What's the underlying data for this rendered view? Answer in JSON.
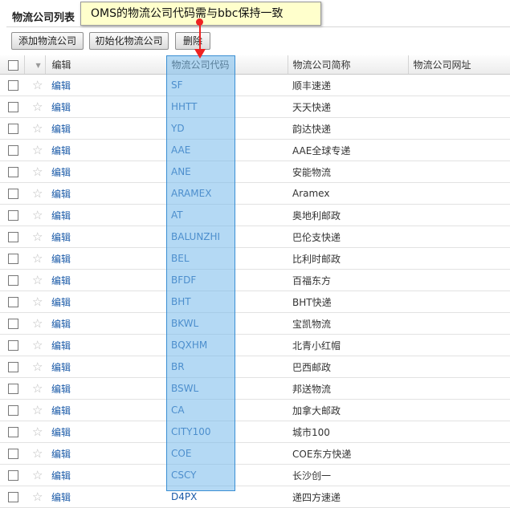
{
  "page": {
    "title": "物流公司列表"
  },
  "toolbar": {
    "add_label": "添加物流公司",
    "init_label": "初始化物流公司",
    "delete_label": "删除"
  },
  "annotation": {
    "text": "OMS的物流公司代码需与bbc保持一致"
  },
  "table": {
    "headers": {
      "edit": "编辑",
      "code": "物流公司代码",
      "name": "物流公司简称",
      "url": "物流公司网址"
    },
    "rows": [
      {
        "edit": "编辑",
        "code": "SF",
        "name": "顺丰速递"
      },
      {
        "edit": "编辑",
        "code": "HHTT",
        "name": "天天快递"
      },
      {
        "edit": "编辑",
        "code": "YD",
        "name": "韵达快递"
      },
      {
        "edit": "编辑",
        "code": "AAE",
        "name": "AAE全球专递"
      },
      {
        "edit": "编辑",
        "code": "ANE",
        "name": "安能物流"
      },
      {
        "edit": "编辑",
        "code": "ARAMEX",
        "name": "Aramex"
      },
      {
        "edit": "编辑",
        "code": "AT",
        "name": "奥地利邮政"
      },
      {
        "edit": "编辑",
        "code": "BALUNZHI",
        "name": "巴伦支快递"
      },
      {
        "edit": "编辑",
        "code": "BEL",
        "name": "比利时邮政"
      },
      {
        "edit": "编辑",
        "code": "BFDF",
        "name": "百福东方"
      },
      {
        "edit": "编辑",
        "code": "BHT",
        "name": "BHT快递"
      },
      {
        "edit": "编辑",
        "code": "BKWL",
        "name": "宝凯物流"
      },
      {
        "edit": "编辑",
        "code": "BQXHM",
        "name": "北青小红帽"
      },
      {
        "edit": "编辑",
        "code": "BR",
        "name": "巴西邮政"
      },
      {
        "edit": "编辑",
        "code": "BSWL",
        "name": "邦送物流"
      },
      {
        "edit": "编辑",
        "code": "CA",
        "name": "加拿大邮政"
      },
      {
        "edit": "编辑",
        "code": "CITY100",
        "name": "城市100"
      },
      {
        "edit": "编辑",
        "code": "COE",
        "name": "COE东方快递"
      },
      {
        "edit": "编辑",
        "code": "CSCY",
        "name": "长沙创一"
      },
      {
        "edit": "编辑",
        "code": "D4PX",
        "name": "递四方速递"
      }
    ]
  },
  "colors": {
    "highlight": "#76b9eb",
    "annotation_pin": "#e22222",
    "link": "#1a5aa8"
  }
}
